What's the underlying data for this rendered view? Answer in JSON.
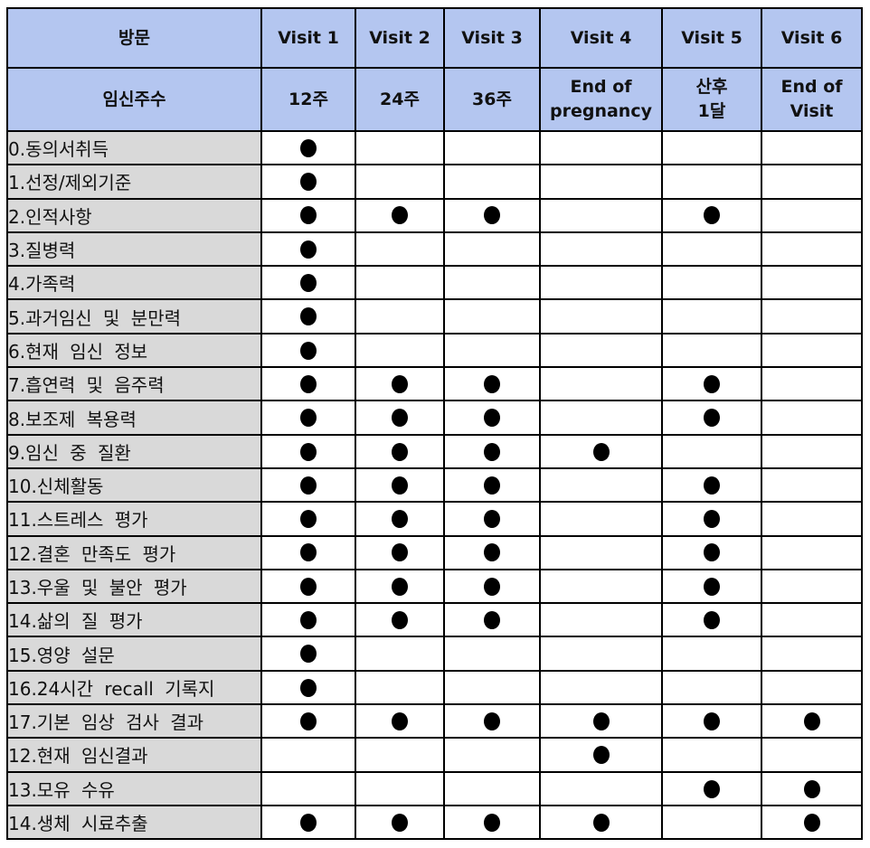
{
  "table": {
    "header_row1": {
      "label": "방문",
      "visits": [
        "Visit 1",
        "Visit 2",
        "Visit 3",
        "Visit 4",
        "Visit 5",
        "Visit 6"
      ]
    },
    "header_row2": {
      "label": "임신주수",
      "timepoints": [
        "12주",
        "24주",
        "36주",
        "End of\npregnancy",
        "산후\n1달",
        "End of\nVisit"
      ]
    },
    "marker_icon": "filled-circle-icon",
    "rows": [
      {
        "label": "0.동의서취득",
        "marks": [
          true,
          false,
          false,
          false,
          false,
          false
        ]
      },
      {
        "label": "1.선정/제외기준",
        "marks": [
          true,
          false,
          false,
          false,
          false,
          false
        ]
      },
      {
        "label": "2.인적사항",
        "marks": [
          true,
          true,
          true,
          false,
          true,
          false
        ]
      },
      {
        "label": "3.질병력",
        "marks": [
          true,
          false,
          false,
          false,
          false,
          false
        ]
      },
      {
        "label": "4.가족력",
        "marks": [
          true,
          false,
          false,
          false,
          false,
          false
        ]
      },
      {
        "label": "5.과거임신 및 분만력",
        "marks": [
          true,
          false,
          false,
          false,
          false,
          false
        ]
      },
      {
        "label": "6.현재 임신 정보",
        "marks": [
          true,
          false,
          false,
          false,
          false,
          false
        ]
      },
      {
        "label": "7.흡연력 및 음주력",
        "marks": [
          true,
          true,
          true,
          false,
          true,
          false
        ]
      },
      {
        "label": "8.보조제 복용력",
        "marks": [
          true,
          true,
          true,
          false,
          true,
          false
        ]
      },
      {
        "label": "9.임신 중 질환",
        "marks": [
          true,
          true,
          true,
          true,
          false,
          false
        ]
      },
      {
        "label": "10.신체활동",
        "marks": [
          true,
          true,
          true,
          false,
          true,
          false
        ]
      },
      {
        "label": "11.스트레스 평가",
        "marks": [
          true,
          true,
          true,
          false,
          true,
          false
        ]
      },
      {
        "label": "12.결혼 만족도 평가",
        "marks": [
          true,
          true,
          true,
          false,
          true,
          false
        ]
      },
      {
        "label": "13.우울 및 불안 평가",
        "marks": [
          true,
          true,
          true,
          false,
          true,
          false
        ]
      },
      {
        "label": "14.삶의 질 평가",
        "marks": [
          true,
          true,
          true,
          false,
          true,
          false
        ]
      },
      {
        "label": "15.영양 설문",
        "marks": [
          true,
          false,
          false,
          false,
          false,
          false
        ]
      },
      {
        "label": "16.24시간 recall 기록지",
        "marks": [
          true,
          false,
          false,
          false,
          false,
          false
        ]
      },
      {
        "label": "17.기본 임상 검사 결과",
        "marks": [
          true,
          true,
          true,
          true,
          true,
          true
        ]
      },
      {
        "label": "12.현재 임신결과",
        "marks": [
          false,
          false,
          false,
          true,
          false,
          false
        ]
      },
      {
        "label": "13.모유 수유",
        "marks": [
          false,
          false,
          false,
          false,
          true,
          true
        ]
      },
      {
        "label": "14.생체 시료추출",
        "marks": [
          true,
          true,
          true,
          true,
          false,
          true
        ]
      }
    ]
  }
}
